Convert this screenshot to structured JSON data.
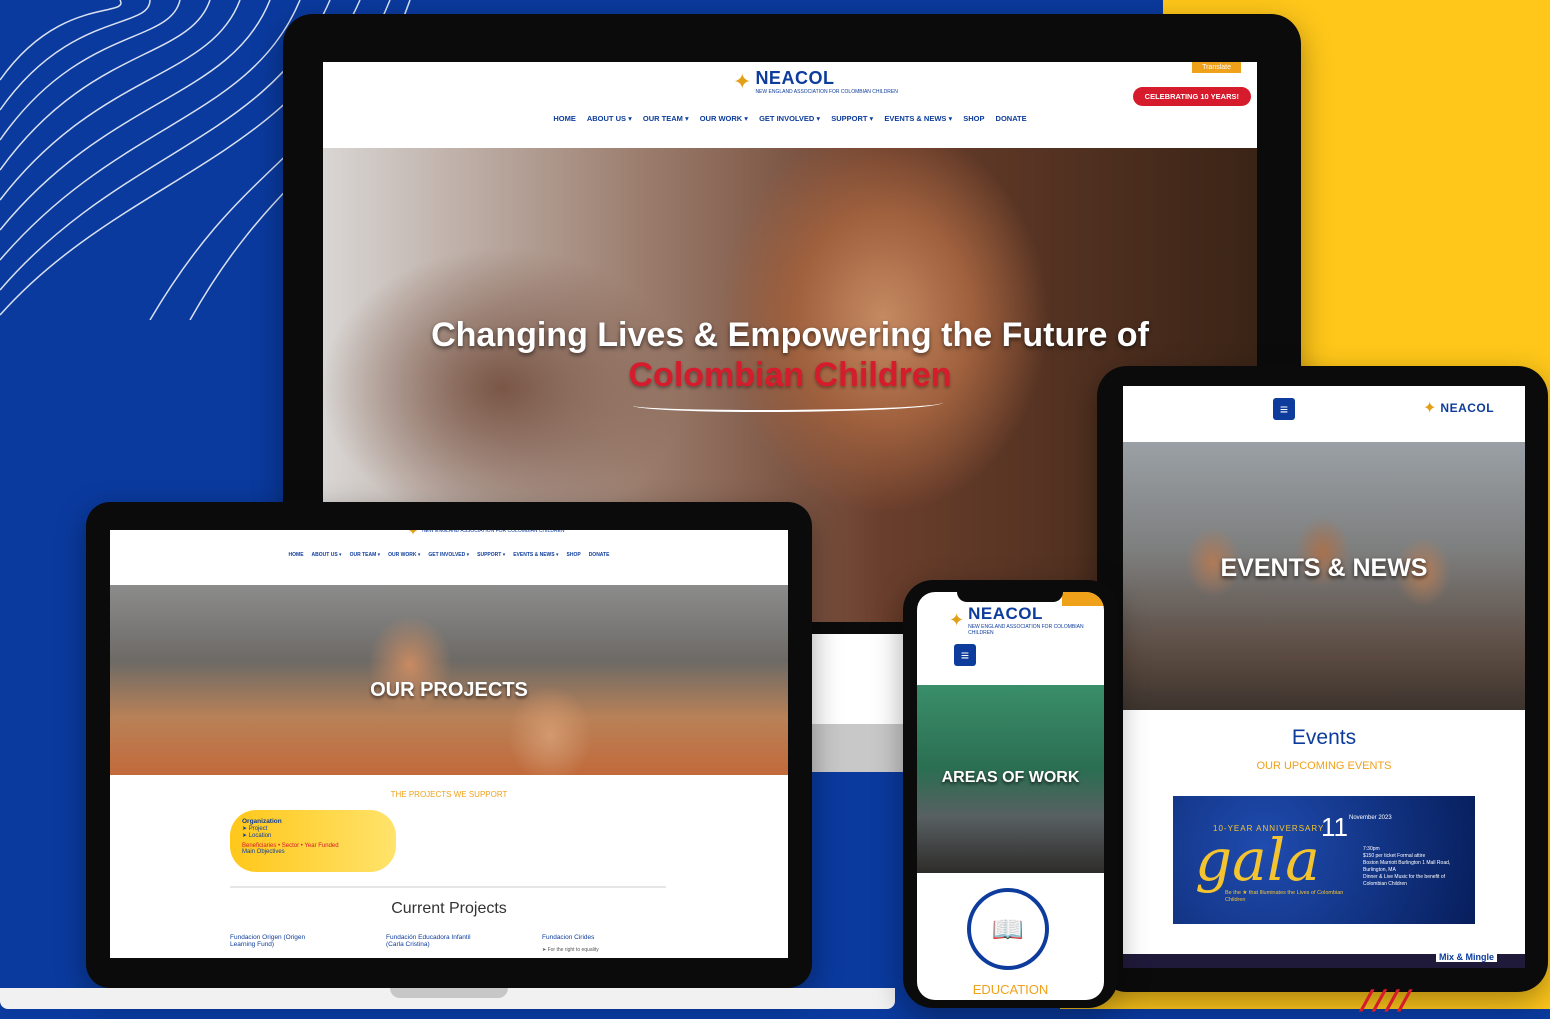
{
  "brand": {
    "name": "NEACOL",
    "tagline": "NEW ENGLAND ASSOCIATION FOR COLOMBIAN CHILDREN"
  },
  "colors": {
    "background_blue": "#0a3a9e",
    "background_yellow": "#ffc71a",
    "brand_blue": "#0d3c9c",
    "brand_red": "#d61b2c",
    "brand_orange": "#f0a11a"
  },
  "desktop": {
    "translate_label": "Translate",
    "celebrate_label": "CELEBRATING 10 YEARS!",
    "nav": [
      "HOME",
      "ABOUT US ▾",
      "OUR TEAM ▾",
      "OUR WORK ▾",
      "GET INVOLVED ▾",
      "SUPPORT ▾",
      "EVENTS & NEWS ▾",
      "SHOP",
      "DONATE"
    ],
    "hero_title": "Changing Lives & Empowering the Future of",
    "hero_highlight": "Colombian Children"
  },
  "laptop": {
    "nav": [
      "HOME",
      "ABOUT US ▾",
      "OUR TEAM ▾",
      "OUR WORK ▾",
      "GET INVOLVED ▾",
      "SUPPORT ▾",
      "EVENTS & NEWS ▾",
      "SHOP",
      "DONATE"
    ],
    "hero_title": "OUR PROJECTS",
    "tagline": "THE PROJECTS WE SUPPORT",
    "org_card": {
      "title": "Organization",
      "line1": "➤ Project",
      "line2": "➤ Location",
      "line3": "Beneficiaries • Sector • Year Funded",
      "line4": "Main Objectives"
    },
    "current_heading": "Current Projects",
    "projects": [
      "Fundacion Origen (Origen Learning Fund)",
      "Fundación Educadora Infantil (Carla Cristina)",
      "Fundacion Cirides"
    ],
    "project_note": "➤ For the right to equality"
  },
  "tablet": {
    "hero_title": "EVENTS & NEWS",
    "events_heading": "Events",
    "events_sub": "OUR UPCOMING EVENTS",
    "gala": {
      "anniversary": "10-YEAR ANNIVERSARY",
      "script": "gala",
      "day": "11",
      "month_year": "November 2023",
      "time": "7:30pm",
      "attire": "$150 per ticket Formal attire",
      "venue": "Boston Marriott Burlington 1 Mall Road, Burlington, MA",
      "program": "Dinner & Live Music for the benefit of Colombian Children",
      "tag": "Be the ★ that Illuminates the Lives of Colombian Children"
    },
    "mix_label": "Mix & Mingle"
  },
  "phone": {
    "hero_title": "AREAS OF WORK",
    "area_label": "EDUCATION"
  }
}
